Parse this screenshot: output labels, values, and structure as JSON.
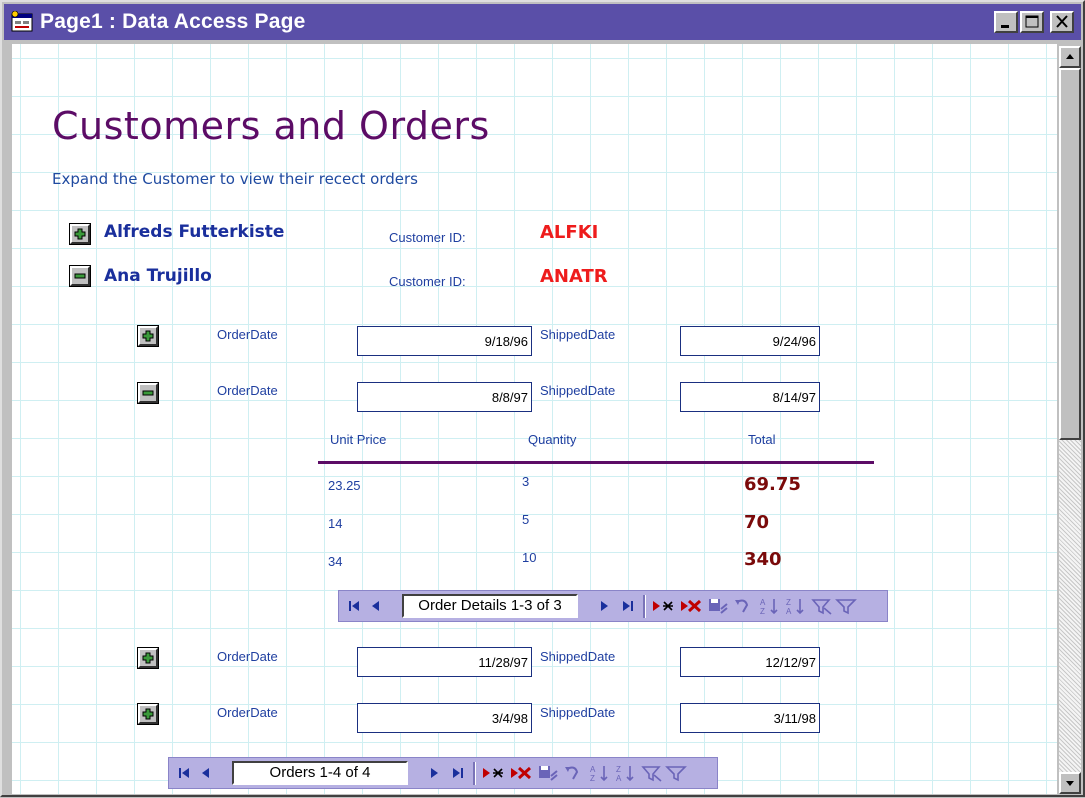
{
  "window": {
    "title": "Page1 : Data Access Page",
    "controls": [
      "minimize-icon",
      "maximize-icon",
      "close-icon"
    ]
  },
  "page": {
    "heading": "Customers and Orders",
    "subheading": "Expand the Customer to view their recect orders"
  },
  "customers": [
    {
      "name": "Alfreds Futterkiste",
      "id_label": "Customer ID:",
      "id": "ALFKI",
      "expanded": false
    },
    {
      "name": "Ana Trujillo",
      "id_label": "Customer ID:",
      "id": "ANATR",
      "expanded": true
    }
  ],
  "orders": [
    {
      "order_label": "OrderDate",
      "order_date": "9/18/96",
      "shipped_label": "ShippedDate",
      "shipped_date": "9/24/96",
      "expanded": false
    },
    {
      "order_label": "OrderDate",
      "order_date": "8/8/97",
      "shipped_label": "ShippedDate",
      "shipped_date": "8/14/97",
      "expanded": true
    },
    {
      "order_label": "OrderDate",
      "order_date": "11/28/97",
      "shipped_label": "ShippedDate",
      "shipped_date": "12/12/97",
      "expanded": false
    },
    {
      "order_label": "OrderDate",
      "order_date": "3/4/98",
      "shipped_label": "ShippedDate",
      "shipped_date": "3/11/98",
      "expanded": false
    }
  ],
  "details": {
    "headers": [
      "Unit Price",
      "Quantity",
      "Total"
    ],
    "rows": [
      {
        "unit_price": "23.25",
        "quantity": "3",
        "total": "69.75"
      },
      {
        "unit_price": "14",
        "quantity": "5",
        "total": "70"
      },
      {
        "unit_price": "34",
        "quantity": "10",
        "total": "340"
      }
    ]
  },
  "nav_details": {
    "record_text": "Order Details 1-3 of 3"
  },
  "nav_orders": {
    "record_text": "Orders 1-4 of 4"
  },
  "nav_icons": [
    "first-record-icon",
    "previous-record-icon",
    "next-record-icon",
    "last-record-icon",
    "new-record-icon",
    "delete-record-icon",
    "save-record-icon",
    "undo-icon",
    "sort-ascending-icon",
    "sort-descending-icon",
    "filter-by-selection-icon",
    "toggle-filter-icon"
  ],
  "colors": {
    "title_bar": "#5a4fa8",
    "heading": "#5c0c66",
    "customer_name": "#1a2f9c",
    "customer_id": "#ee1c1c",
    "total": "#7a0a0a",
    "nav_bar": "#b6b0e2",
    "grid": "#cfeff2"
  }
}
